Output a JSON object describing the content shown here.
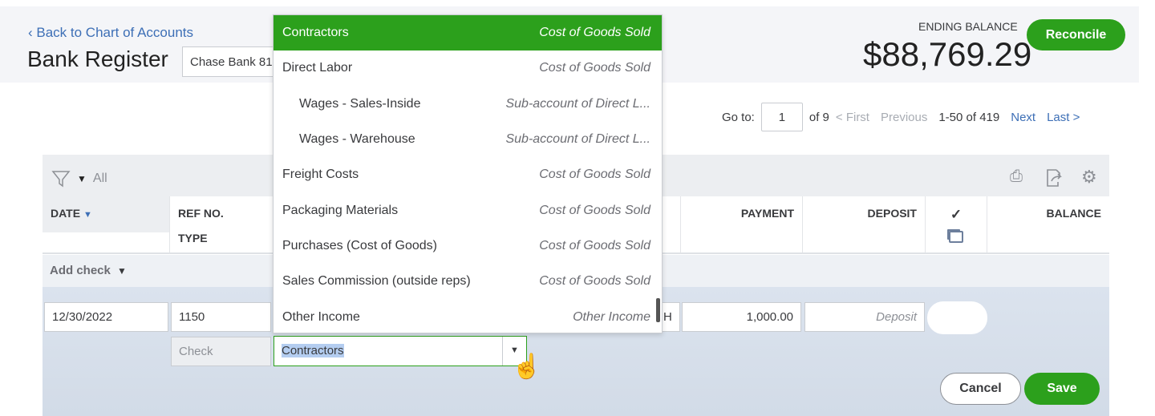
{
  "header": {
    "back_link": "Back to Chart of Accounts",
    "title": "Bank Register",
    "account": "Chase Bank 81",
    "ending_balance_label": "ENDING BALANCE",
    "ending_balance": "$88,769.29",
    "reconcile": "Reconcile"
  },
  "pager": {
    "goto_label": "Go to:",
    "page": "1",
    "of": "of 9",
    "first": "< First",
    "previous": "Previous",
    "range": "1-50 of 419",
    "next": "Next",
    "last": "Last >"
  },
  "filter": {
    "value": "All"
  },
  "columns": {
    "date": "DATE",
    "ref": "REF NO.",
    "type": "TYPE",
    "payment": "PAYMENT",
    "deposit": "DEPOSIT",
    "check": "✓",
    "balance": "BALANCE"
  },
  "add_check": "Add check",
  "edit": {
    "date": "12/30/2022",
    "ref": "1150",
    "type": "Check",
    "payee_tail": "H",
    "payment": "1,000.00",
    "deposit_placeholder": "Deposit",
    "account": "Contractors",
    "cancel": "Cancel",
    "save": "Save"
  },
  "dropdown": [
    {
      "name": "Contractors",
      "type": "Cost of Goods Sold",
      "selected": true
    },
    {
      "name": "Direct Labor",
      "type": "Cost of Goods Sold"
    },
    {
      "name": "Wages - Sales-Inside",
      "type": "Sub-account of Direct L...",
      "sub": true
    },
    {
      "name": "Wages - Warehouse",
      "type": "Sub-account of Direct L...",
      "sub": true
    },
    {
      "name": "Freight Costs",
      "type": "Cost of Goods Sold"
    },
    {
      "name": "Packaging Materials",
      "type": "Cost of Goods Sold"
    },
    {
      "name": "Purchases (Cost of Goods)",
      "type": "Cost of Goods Sold"
    },
    {
      "name": "Sales Commission (outside reps)",
      "type": "Cost of Goods Sold"
    },
    {
      "name": "Other Income",
      "type": "Other Income"
    }
  ],
  "colors": {
    "green": "#2ca01c",
    "link": "#3d6fb6"
  }
}
